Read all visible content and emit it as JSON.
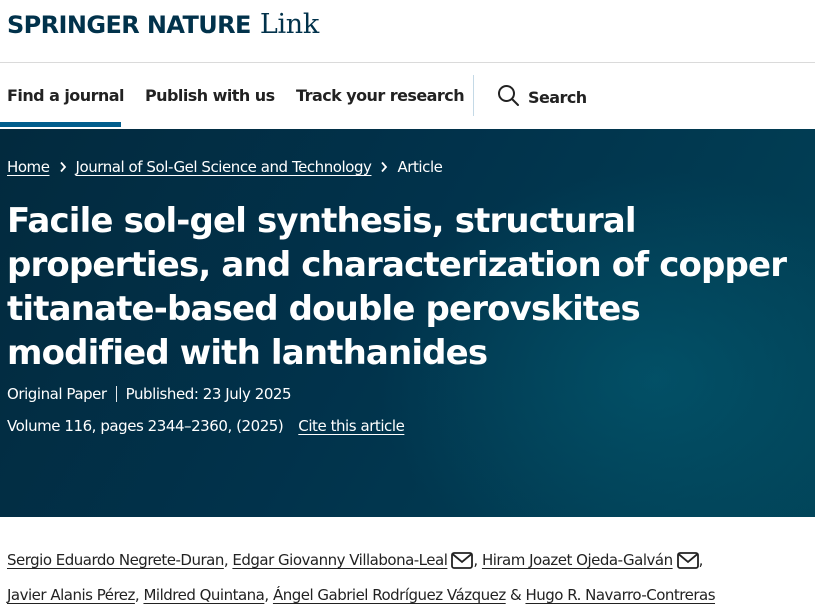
{
  "brand": {
    "springer_nature": "SPRINGER NATURE",
    "link": "Link",
    "color": "#01324b"
  },
  "nav": {
    "items": [
      {
        "label": "Find a journal",
        "active": true
      },
      {
        "label": "Publish with us",
        "active": false
      },
      {
        "label": "Track your research",
        "active": false
      }
    ],
    "search_label": "Search",
    "search_icon": "search-icon",
    "active_underline_color": "#025e8d"
  },
  "breadcrumb": {
    "home": "Home",
    "journal": "Journal of Sol-Gel Science and Technology",
    "current": "Article",
    "separator_icon": "chevron-right-icon"
  },
  "article": {
    "title": "Facile sol-gel synthesis, structural properties, and characterization of copper titanate-based double perovskites modified with lanthanides",
    "type": "Original Paper",
    "published": "Published: 23 July 2025",
    "volume": "Volume 116, pages 2344–2360, (2025)",
    "cite": "Cite this article",
    "hero_color": "#01324b"
  },
  "authors": {
    "list": [
      "Sergio Eduardo Negrete-Duran",
      "Edgar Giovanny Villabona-Leal",
      "Hiram Joazet Ojeda-Galván",
      "Javier Alanis Pérez",
      "Mildred Quintana",
      "Ángel Gabriel Rodríguez Vázquez",
      "Hugo R. Navarro-Contreras"
    ],
    "mail_icon": "mail-icon",
    "separator": ",",
    "final_separator": "&"
  }
}
